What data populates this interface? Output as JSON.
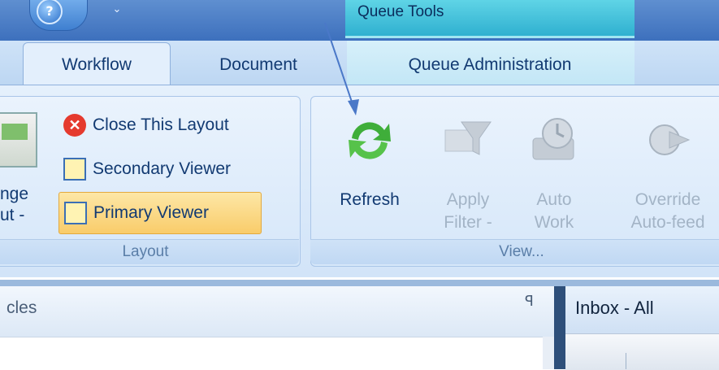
{
  "title_bar": {
    "help_glyph": "?",
    "qat_chevron": "⌄",
    "contextual_title": "Queue Tools"
  },
  "tabs": [
    {
      "label": "Workflow",
      "active": true
    },
    {
      "label": "Document",
      "active": false
    },
    {
      "label": "Queue Administration",
      "active": false
    }
  ],
  "layout_group": {
    "change_layout_label_line1": "nge",
    "change_layout_label_line2": "ut -",
    "close_layout": "Close This Layout",
    "secondary_viewer": "Secondary Viewer",
    "primary_viewer": "Primary Viewer",
    "group_label": "Layout"
  },
  "view_group": {
    "refresh": "Refresh",
    "apply_filter_line1": "Apply",
    "apply_filter_line2": "Filter -",
    "auto_work_line1": "Auto",
    "auto_work_line2": "Work",
    "override_line1": "Override",
    "override_line2": "Auto-feed",
    "group_label": "View..."
  },
  "left_pane": {
    "title": "cles",
    "pin_glyph": "ꟼ"
  },
  "right_pane": {
    "title": "Inbox - All"
  },
  "colors": {
    "title_bar": "#3d70bd",
    "contextual": "#2fb0d0",
    "ribbon": "#d2e4f8",
    "highlight": "#f9cc6a",
    "arrow": "#4a78c8"
  }
}
